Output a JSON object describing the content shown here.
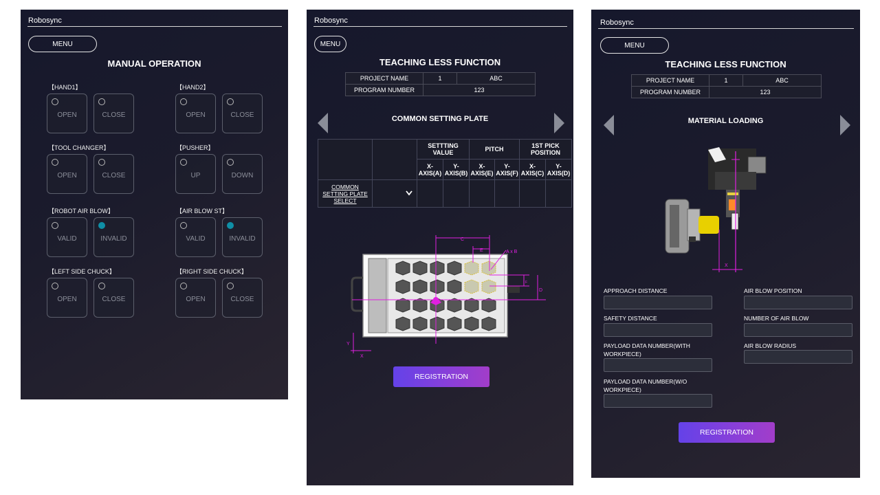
{
  "brand": "Robosync",
  "menu_label": "MENU",
  "manual": {
    "title": "MANUAL OPERATION",
    "groups": [
      {
        "label": "【HAND1】",
        "buttons": [
          {
            "label": "OPEN",
            "on": false
          },
          {
            "label": "CLOSE",
            "on": false
          }
        ]
      },
      {
        "label": "【HAND2】",
        "buttons": [
          {
            "label": "OPEN",
            "on": false
          },
          {
            "label": "CLOSE",
            "on": false
          }
        ]
      },
      {
        "label": "【TOOL CHANGER】",
        "buttons": [
          {
            "label": "OPEN",
            "on": false
          },
          {
            "label": "CLOSE",
            "on": false
          }
        ]
      },
      {
        "label": "【PUSHER】",
        "buttons": [
          {
            "label": "UP",
            "on": false
          },
          {
            "label": "DOWN",
            "on": false
          }
        ]
      },
      {
        "label": "【ROBOT AIR BLOW】",
        "buttons": [
          {
            "label": "VALID",
            "on": false
          },
          {
            "label": "INVALID",
            "on": true
          }
        ]
      },
      {
        "label": "【AIR BLOW ST】",
        "buttons": [
          {
            "label": "VALID",
            "on": false
          },
          {
            "label": "INVALID",
            "on": true
          }
        ]
      },
      {
        "label": "【LEFT SIDE CHUCK】",
        "buttons": [
          {
            "label": "OPEN",
            "on": false
          },
          {
            "label": "CLOSE",
            "on": false
          }
        ]
      },
      {
        "label": "【RIGHT SIDE CHUCK】",
        "buttons": [
          {
            "label": "OPEN",
            "on": false
          },
          {
            "label": "CLOSE",
            "on": false
          }
        ]
      }
    ]
  },
  "teaching": {
    "title": "TEACHING LESS FUNCTION",
    "project_name_label": "PROJECT NAME",
    "project_number": "1",
    "project_name": "ABC",
    "program_number_label": "PROGRAM NUMBER",
    "program_number": "123"
  },
  "plate": {
    "section_title": "COMMON SETTING PLATE",
    "headers": [
      "SETTTING VALUE",
      "PITCH",
      "1ST PICK POSITION"
    ],
    "subheaders": [
      "X-AXIS(A)",
      "Y-AXIS(B)",
      "X-AXIS(E)",
      "Y-AXIS(F)",
      "X-AXIS(C)",
      "Y-AXIS(D)"
    ],
    "row_label": "COMMON SETTING PLATE SELECT",
    "dim_labels": {
      "c": "C",
      "e": "E",
      "ab": "A x B",
      "f": "F",
      "d": "D",
      "y": "Y",
      "x": "X"
    },
    "registration": "REGISTRATION"
  },
  "loading": {
    "section_title": "MATERIAL LOADING",
    "axis_x": "X",
    "fields_left": [
      "APPROACH DISTANCE",
      "SAFETY DISTANCE",
      "PAYLOAD DATA NUMBER(WITH WORKPIECE)",
      "PAYLOAD DATA NUMBER(W/O WORKPIECE)"
    ],
    "fields_right": [
      "AIR BLOW POSITION",
      "NUMBER OF AIR BLOW",
      "AIR BLOW RADIUS"
    ],
    "registration": "REGISTRATION"
  },
  "colors": {
    "accent": "#6442e8",
    "lamp_on": "#0f8fa6",
    "magenta": "#e020e0"
  }
}
